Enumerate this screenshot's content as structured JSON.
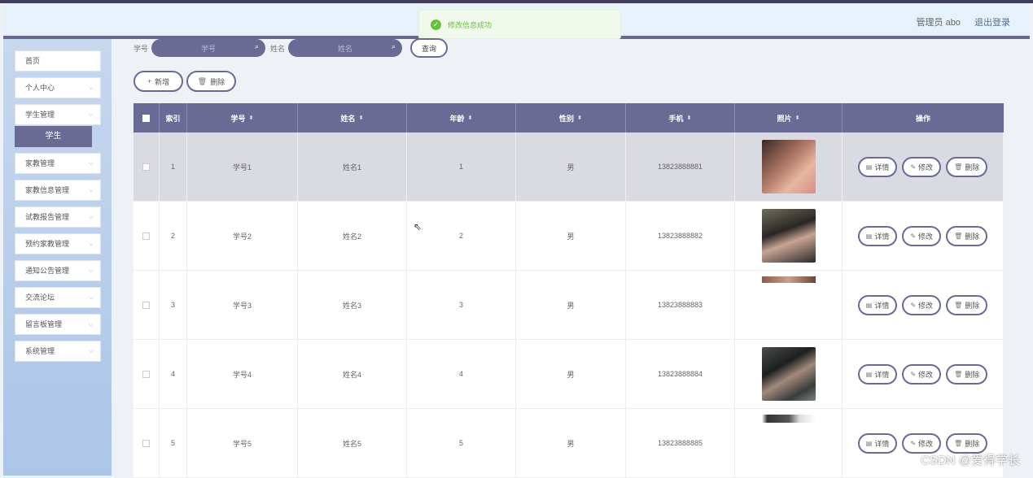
{
  "header": {
    "user": "管理员 abo",
    "logout": "退出登录"
  },
  "toast": {
    "message": "修改信息成功"
  },
  "sidebar": {
    "items": [
      {
        "label": "首页",
        "chevron": false
      },
      {
        "label": "个人中心",
        "chevron": true
      },
      {
        "label": "学生管理",
        "chevron": true
      },
      {
        "label": "家教管理",
        "chevron": true
      },
      {
        "label": "家教信息管理",
        "chevron": true
      },
      {
        "label": "试教报告管理",
        "chevron": true
      },
      {
        "label": "预约家教管理",
        "chevron": true
      },
      {
        "label": "通知公告管理",
        "chevron": true
      },
      {
        "label": "交流论坛",
        "chevron": true
      },
      {
        "label": "留言板管理",
        "chevron": true
      },
      {
        "label": "系统管理",
        "chevron": true
      }
    ],
    "sub_active": "学生"
  },
  "search": {
    "sno_label": "学号",
    "sno_placeholder": "学号",
    "name_label": "姓名",
    "name_placeholder": "姓名",
    "query_button": "查询"
  },
  "actions": {
    "add": "新增",
    "delete": "删除"
  },
  "table": {
    "headers": {
      "index": "索引",
      "sno": "学号",
      "name": "姓名",
      "age": "年龄",
      "sex": "性别",
      "phone": "手机",
      "photo": "照片",
      "ops": "操作"
    },
    "ops": {
      "detail": "详情",
      "edit": "修改",
      "delete": "删除"
    },
    "rows": [
      {
        "index": "1",
        "sno": "学号1",
        "name": "姓名1",
        "age": "1",
        "sex": "男",
        "phone": "13823888881"
      },
      {
        "index": "2",
        "sno": "学号2",
        "name": "姓名2",
        "age": "2",
        "sex": "男",
        "phone": "13823888882"
      },
      {
        "index": "3",
        "sno": "学号3",
        "name": "姓名3",
        "age": "3",
        "sex": "男",
        "phone": "13823888883"
      },
      {
        "index": "4",
        "sno": "学号4",
        "name": "姓名4",
        "age": "4",
        "sex": "男",
        "phone": "13823888884"
      },
      {
        "index": "5",
        "sno": "学号5",
        "name": "姓名5",
        "age": "5",
        "sex": "男",
        "phone": "13823888885"
      }
    ]
  },
  "watermark": "CSDN @爱得学长",
  "colors": {
    "accent": "#696b95",
    "sidebar": "#abc5e8",
    "success": "#67c23a"
  }
}
